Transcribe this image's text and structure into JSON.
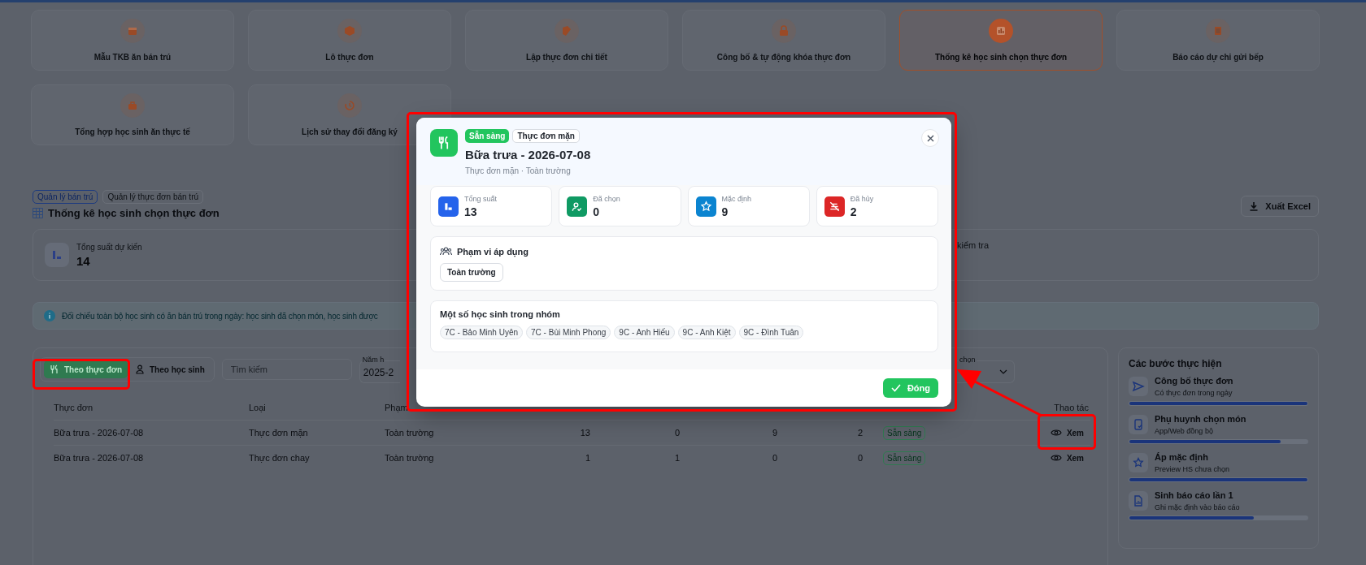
{
  "nav_tiles": [
    {
      "label": "Mẫu TKB ăn bán trú",
      "selected": false
    },
    {
      "label": "Lô thực đơn",
      "selected": false
    },
    {
      "label": "Lập thực đơn chi tiết",
      "selected": false
    },
    {
      "label": "Công bố & tự động khóa thực đơn",
      "selected": false
    },
    {
      "label": "Thống kê học sinh chọn thực đơn",
      "selected": true
    },
    {
      "label": "Báo cáo dự chi gửi bếp",
      "selected": false
    },
    {
      "label": "Tổng hợp học sinh ăn thực tế",
      "selected": false
    },
    {
      "label": "Lịch sử thay đổi đăng ký",
      "selected": false
    }
  ],
  "breadcrumb": [
    {
      "label": "Quản lý bán trú",
      "selected": true
    },
    {
      "label": "Quản lý thực đơn bán trú",
      "selected": false
    }
  ],
  "page_title": "Thống kê học sinh chọn thực đơn",
  "export_button": "Xuất Excel",
  "summary": {
    "label": "Tổng suất dự kiến",
    "value": "14",
    "column_2_label": "kiểm tra"
  },
  "info_banner": "Đối chiếu toàn bộ học sinh có ăn bán trú trong ngày: học sinh đã chọn món, học sinh được",
  "view_toggle": [
    {
      "label": "Theo thực đơn",
      "selected": true
    },
    {
      "label": "Theo học sinh",
      "selected": false
    }
  ],
  "search": {
    "placeholder": "Tìm kiếm"
  },
  "year_filter": {
    "label": "Năm h",
    "value": "2025-2"
  },
  "status_filter": {
    "label": "chọn"
  },
  "table": {
    "columns": {
      "menu": "Thực đơn",
      "type": "Loại",
      "scope": "Phạm",
      "action": "Thao tác"
    },
    "rows": [
      {
        "menu": "Bữa trưa - 2026-07-08",
        "type": "Thực đơn mặn",
        "scope": "Toàn trường",
        "total": "13",
        "chosen": "0",
        "default": "9",
        "cancelled": "2",
        "status": "Sẵn sàng",
        "action": "Xem"
      },
      {
        "menu": "Bữa trưa - 2026-07-08",
        "type": "Thực đơn chay",
        "scope": "Toàn trường",
        "total": "1",
        "chosen": "1",
        "default": "0",
        "cancelled": "0",
        "status": "Sẵn sàng",
        "action": "Xem"
      }
    ]
  },
  "steps": {
    "title": "Các bước thực hiện",
    "items": [
      {
        "title": "Công bố thực đơn",
        "subtitle": "Có thực đơn trong ngày",
        "level": 1
      },
      {
        "title": "Phụ huynh chọn món",
        "subtitle": "App/Web đồng bộ",
        "level": 0.85
      },
      {
        "title": "Áp mặc định",
        "subtitle": "Preview HS chưa chọn",
        "level": 1
      },
      {
        "title": "Sinh báo cáo lần 1",
        "subtitle": "Ghi mặc định vào báo cáo",
        "level": 0.7
      }
    ]
  },
  "modal": {
    "status_badge": "Sẵn sàng",
    "type_badge": "Thực đơn mặn",
    "title": "Bữa trưa - 2026-07-08",
    "subtitle": "Thực đơn mặn · Toàn trường",
    "stats": [
      {
        "kind": "total",
        "label": "Tổng suất",
        "value": "13"
      },
      {
        "kind": "chosen",
        "label": "Đã chọn",
        "value": "0"
      },
      {
        "kind": "default",
        "label": "Mặc định",
        "value": "9"
      },
      {
        "kind": "cancelled",
        "label": "Đã hủy",
        "value": "2"
      }
    ],
    "scope": {
      "title": "Phạm vi áp dụng",
      "chips": [
        "Toàn trường"
      ]
    },
    "students": {
      "title": "Một số học sinh trong nhóm",
      "chips": [
        "7C - Bảo Minh Uyên",
        "7C - Bùi Minh Phong",
        "9C - Anh Hiếu",
        "9C - Anh Kiệt",
        "9C - Đình Tuân"
      ]
    },
    "close_button": "Đóng"
  }
}
